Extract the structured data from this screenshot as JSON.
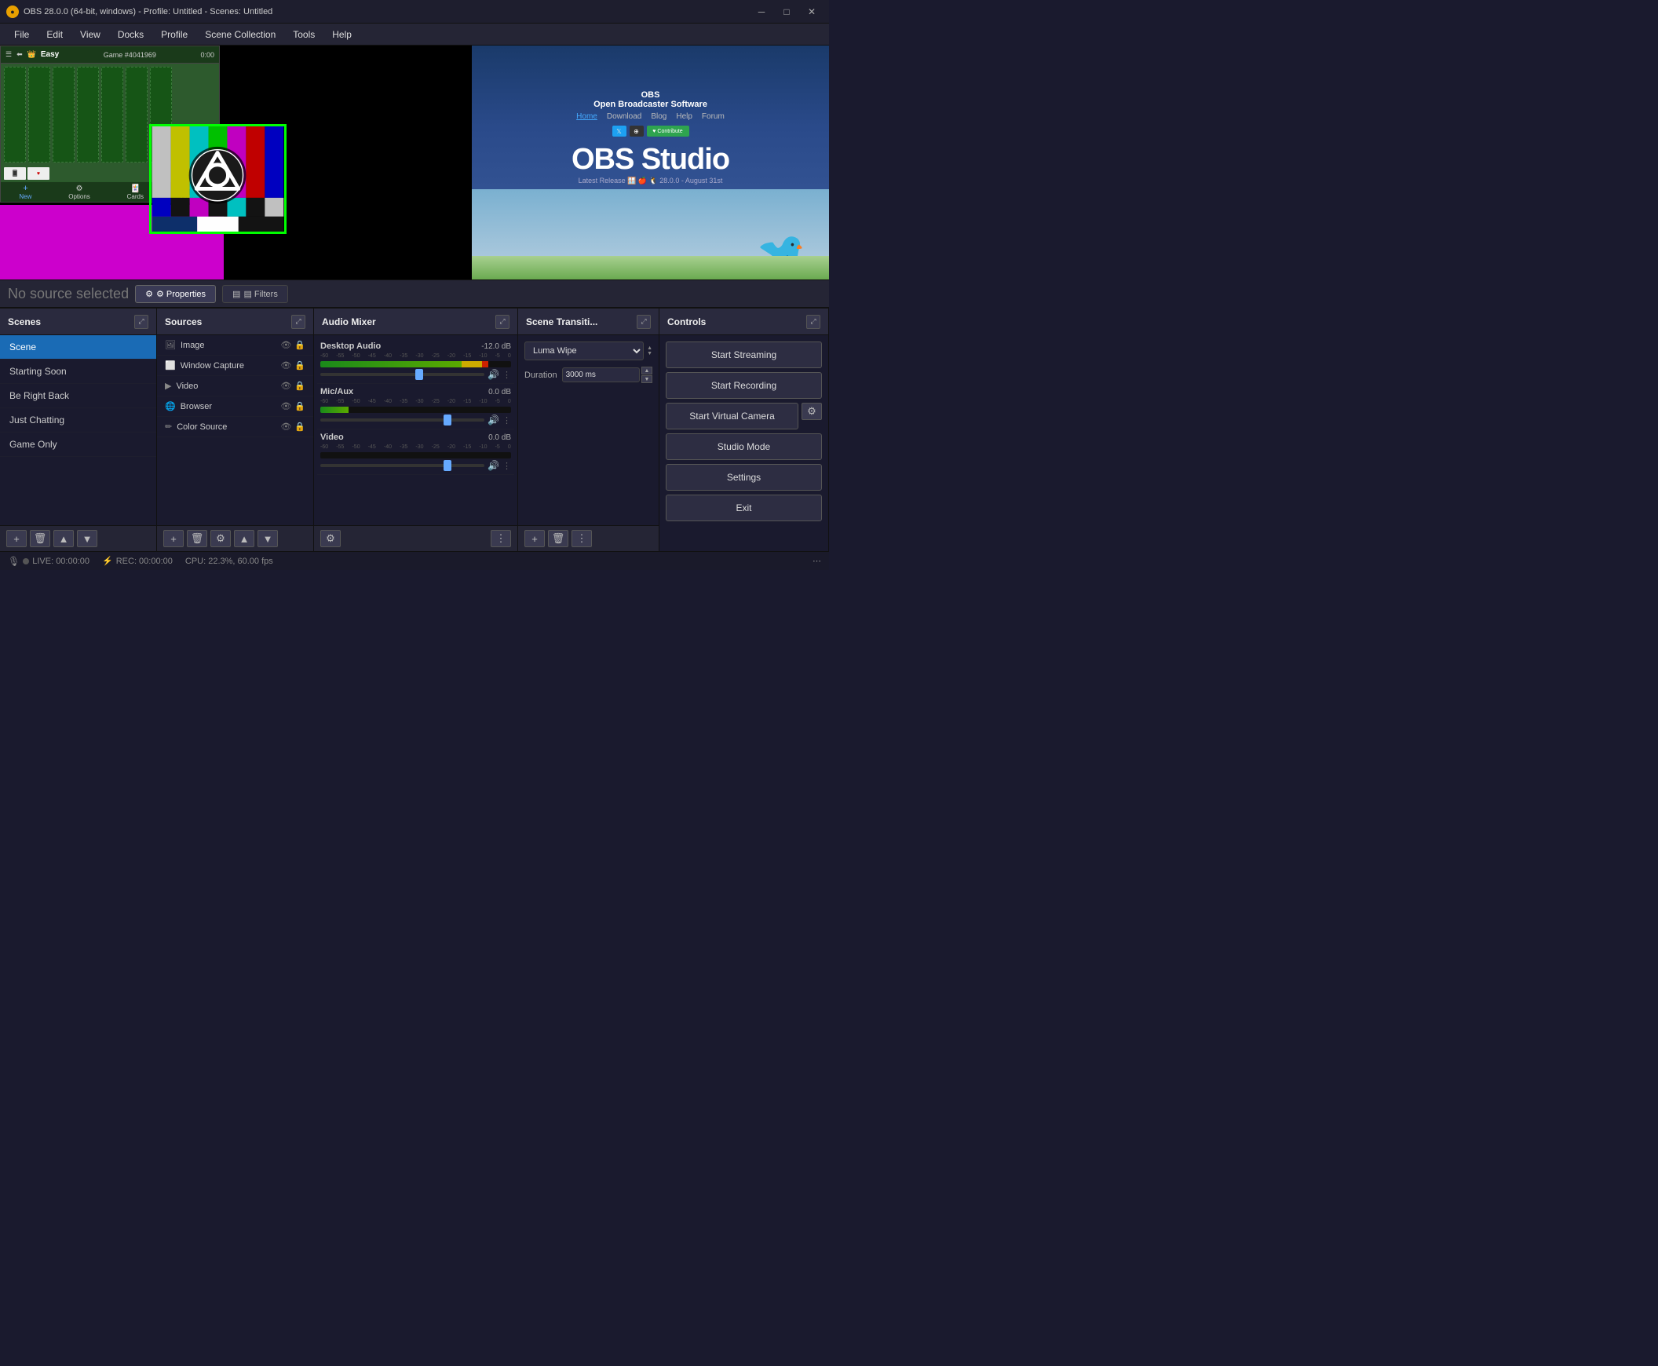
{
  "titlebar": {
    "title": "OBS 28.0.0 (64-bit, windows) - Profile: Untitled - Scenes: Untitled",
    "icon": "●",
    "minimize": "─",
    "maximize": "□",
    "close": "✕"
  },
  "menubar": {
    "items": [
      "File",
      "Edit",
      "View",
      "Docks",
      "Profile",
      "Scene Collection",
      "Tools",
      "Help"
    ]
  },
  "source_status": {
    "no_source": "No source selected",
    "properties_label": "⚙ Properties",
    "filters_label": "▤ Filters"
  },
  "scenes_panel": {
    "title": "Scenes",
    "items": [
      {
        "label": "Scene",
        "active": true
      },
      {
        "label": "Starting Soon",
        "active": false
      },
      {
        "label": "Be Right Back",
        "active": false
      },
      {
        "label": "Just Chatting",
        "active": false
      },
      {
        "label": "Game Only",
        "active": false
      }
    ],
    "footer": {
      "add": "+",
      "remove": "🗑",
      "move_up": "▲",
      "move_down": "▼"
    }
  },
  "sources_panel": {
    "title": "Sources",
    "items": [
      {
        "icon": "🖼",
        "label": "Image"
      },
      {
        "icon": "⬜",
        "label": "Window Capture"
      },
      {
        "icon": "▶",
        "label": "Video"
      },
      {
        "icon": "🌐",
        "label": "Browser"
      },
      {
        "icon": "✏",
        "label": "Color Source"
      }
    ],
    "footer": {
      "add": "+",
      "remove": "🗑",
      "settings": "⚙",
      "move_up": "▲",
      "move_down": "▼"
    }
  },
  "audio_panel": {
    "title": "Audio Mixer",
    "tracks": [
      {
        "name": "Desktop Audio",
        "db": "-12.0 dB",
        "scale": [
          "-60",
          "-55",
          "-50",
          "-45",
          "-40",
          "-35",
          "-30",
          "-25",
          "-20",
          "-15",
          "-10",
          "-5",
          "0"
        ],
        "fader_pos": "58%"
      },
      {
        "name": "Mic/Aux",
        "db": "0.0 dB",
        "scale": [
          "-60",
          "-55",
          "-50",
          "-45",
          "-40",
          "-35",
          "-30",
          "-25",
          "-20",
          "-15",
          "-10",
          "-5",
          "0"
        ],
        "fader_pos": "75%"
      },
      {
        "name": "Video",
        "db": "0.0 dB",
        "scale": [
          "-60",
          "-55",
          "-50",
          "-45",
          "-40",
          "-35",
          "-30",
          "-25",
          "-20",
          "-15",
          "-10",
          "-5",
          "0"
        ],
        "fader_pos": "75%"
      }
    ],
    "settings_icon": "⚙",
    "dots_icon": "⋮"
  },
  "transitions_panel": {
    "title": "Scene Transiti...",
    "transition": "Luma Wipe",
    "duration_label": "Duration",
    "duration_value": "3000 ms",
    "footer": {
      "add": "+",
      "remove": "🗑",
      "dots": "⋮"
    }
  },
  "controls_panel": {
    "title": "Controls",
    "start_streaming": "Start Streaming",
    "start_recording": "Start Recording",
    "start_virtual_camera": "Start Virtual Camera",
    "virtual_camera_settings": "⚙",
    "studio_mode": "Studio Mode",
    "settings": "Settings",
    "exit": "Exit"
  },
  "statusbar": {
    "live_label": "LIVE: 00:00:00",
    "rec_label": "REC: 00:00:00",
    "cpu_label": "CPU: 22.3%, 60.00 fps",
    "resize_icon": "⋯"
  }
}
